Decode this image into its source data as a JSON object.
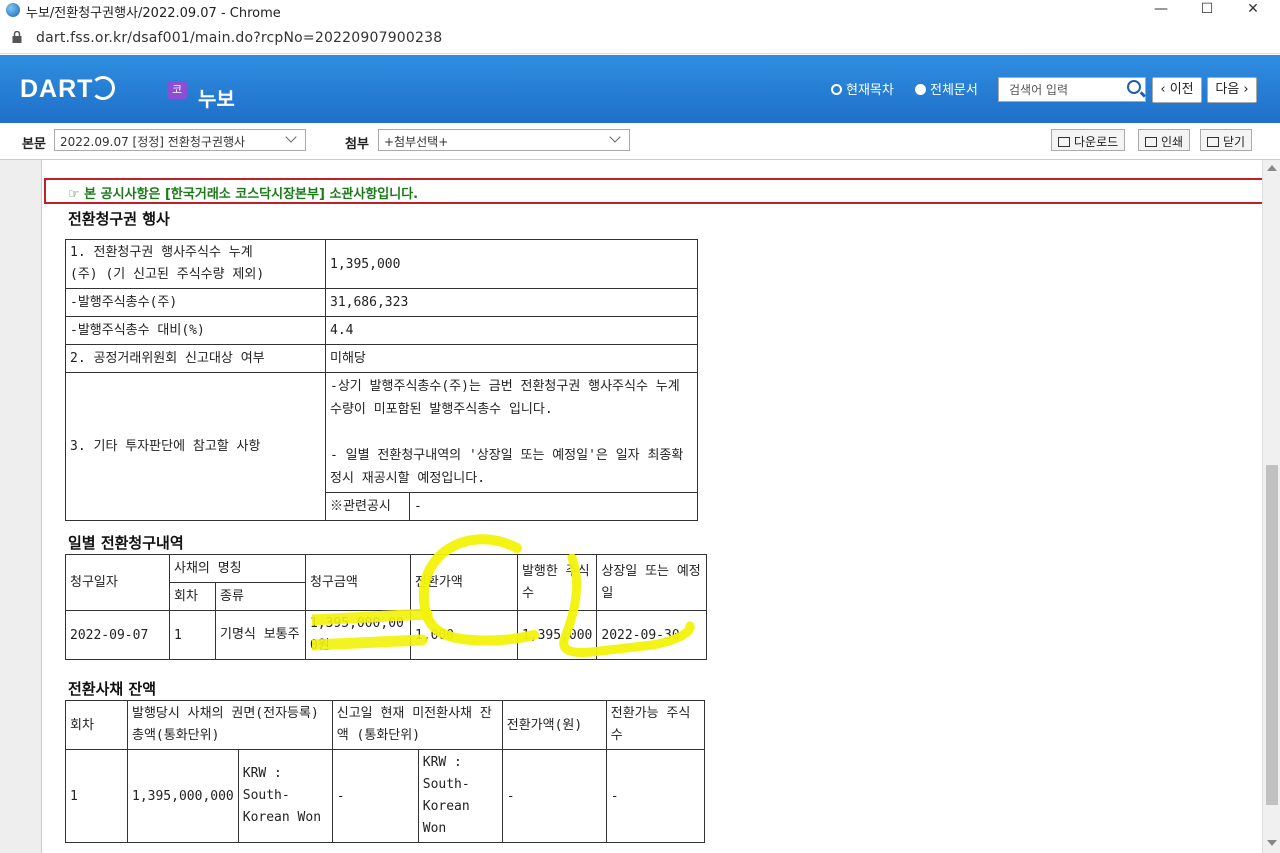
{
  "window": {
    "title": "누보/전환청구권행사/2022.09.07 - Chrome",
    "url": "dart.fss.or.kr/dsaf001/main.do?rcpNo=20220907900238"
  },
  "header": {
    "logo": "DART",
    "badge": "코",
    "doc_title": "누보",
    "radio_toc": "현재목차",
    "radio_all": "전체문서",
    "search_placeholder": "검색어 입력",
    "prev_label": "이전",
    "next_label": "다음"
  },
  "toolbar": {
    "body_label": "본문",
    "body_select": "2022.09.07  [정정] 전환청구권행사",
    "attach_label": "첨부",
    "attach_select": "+첨부선택+",
    "download_label": "다운로드",
    "print_label": "인쇄",
    "close_label": "닫기"
  },
  "notice": "☞ 본 공시사항은 [한국거래소 코스닥시장본부] 소관사항입니다.",
  "section1": {
    "title": "전환청구권 행사",
    "rows": [
      {
        "label": "1. 전환청구권 행사주식수 누계\n(주) (기 신고된 주식수량 제외)",
        "value": "1,395,000"
      },
      {
        "label": "-발행주식총수(주)",
        "value": "31,686,323"
      },
      {
        "label": "-발행주식총수 대비(%)",
        "value": "4.4"
      },
      {
        "label": "2. 공정거래위원회 신고대상 여부",
        "value": "미해당"
      },
      {
        "label": "3. 기타 투자판단에 참고할 사항",
        "value": "-상기 발행주식총수(주)는 금번 전환청구권 행사주식수 누계 수량이 미포함된 발행주식총수 입니다.\n\n- 일별 전환청구내역의 '상장일 또는 예정일'은 일자 최종확정시 재공시할 예정입니다."
      }
    ],
    "related_label": "※관련공시",
    "related_value": "-"
  },
  "section2": {
    "title": "일별 전환청구내역",
    "headers": {
      "date": "청구일자",
      "bond_name": "사채의 명칭",
      "round": "회차",
      "kind": "종류",
      "amount": "청구금액",
      "price": "전환가액",
      "issued": "발행한 주식수",
      "listing": "상장일 또는 예정일"
    },
    "row": {
      "date": "2022-09-07",
      "round": "1",
      "kind": "기명식 보통주",
      "amount": "1,395,000,000원",
      "price": "1,000",
      "issued": "1,395,000",
      "listing": "2022-09-30"
    }
  },
  "section3": {
    "title": "전환사채 잔액",
    "headers": {
      "round": "회차",
      "face": "발행당시 사채의 권면(전자등록)총액(통화단위)",
      "remain": "신고일 현재 미전환사채 잔액 (통화단위)",
      "price": "전환가액(원)",
      "convertible": "전환가능 주식수"
    },
    "row": {
      "round": "1",
      "face_amount": "1,395,000,000",
      "face_currency": "KRW : South-Korean Won",
      "remain_amount": "-",
      "remain_currency": "KRW : South-Korean Won",
      "price": "-",
      "convertible": "-"
    }
  },
  "colors": {
    "header_blue": "#2f8ee0",
    "notice_border": "#c0202a",
    "notice_text": "#1a7a1a",
    "highlight": "#f2f20a"
  }
}
